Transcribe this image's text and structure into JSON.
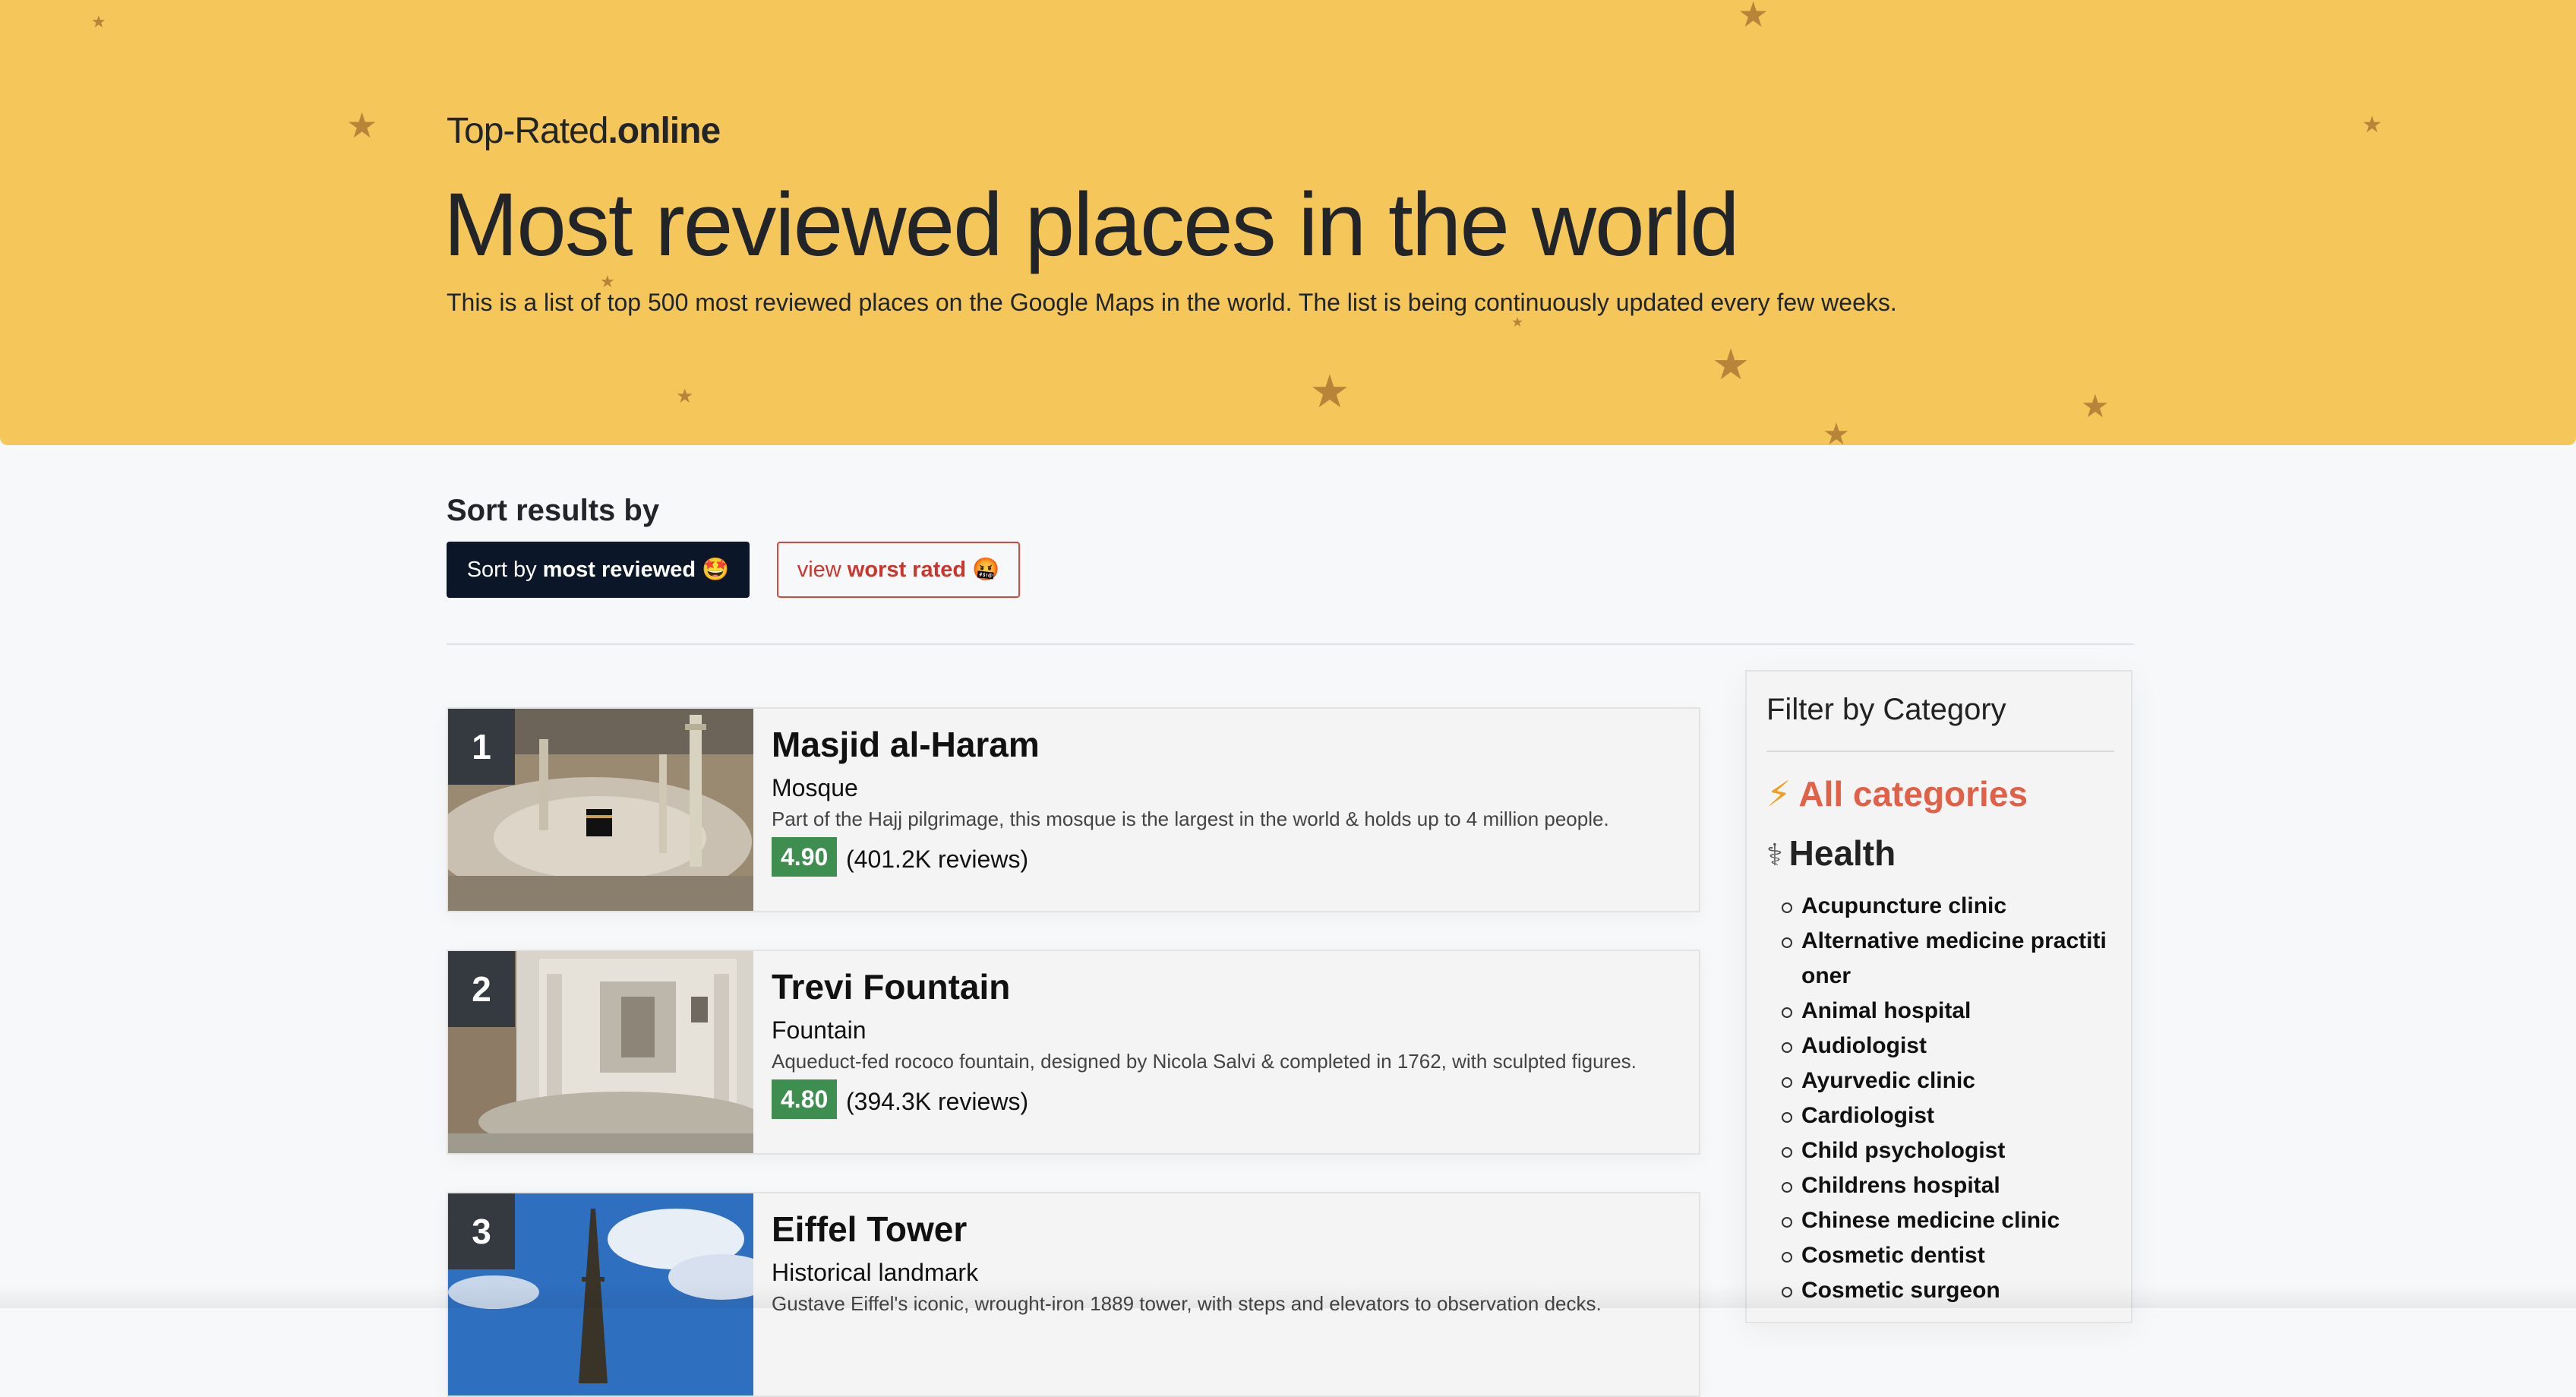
{
  "header": {
    "brand_light": "Top-Rated",
    "brand_bold": ".online",
    "title": "Most reviewed places in the world",
    "description": "This is a list of top 500 most reviewed places on the Google Maps in the world. The list is being continuously updated every few weeks.",
    "background_color": "#f5c65a"
  },
  "sort": {
    "heading": "Sort results by",
    "most_reviewed_prefix": "Sort by ",
    "most_reviewed_bold": "most reviewed",
    "most_reviewed_emoji": "🤩",
    "worst_rated_prefix": "view ",
    "worst_rated_bold": "worst rated",
    "worst_rated_emoji": "🤬"
  },
  "places": [
    {
      "rank": "1",
      "name": "Masjid al-Haram",
      "category": "Mosque",
      "description": "Part of the Hajj pilgrimage, this mosque is the largest in the world & holds up to 4 million people.",
      "rating": "4.90",
      "reviews": "(401.2K reviews)"
    },
    {
      "rank": "2",
      "name": "Trevi Fountain",
      "category": "Fountain",
      "description": "Aqueduct-fed rococo fountain, designed by Nicola Salvi & completed in 1762, with sculpted figures.",
      "rating": "4.80",
      "reviews": "(394.3K reviews)"
    },
    {
      "rank": "3",
      "name": "Eiffel Tower",
      "category": "Historical landmark",
      "description": "Gustave Eiffel's iconic, wrought-iron 1889 tower, with steps and elevators to observation decks.",
      "rating": "",
      "reviews": ""
    }
  ],
  "filter": {
    "title": "Filter by Category",
    "all_categories": "All categories",
    "group_health": "Health",
    "health_items": [
      "Acupuncture clinic",
      "Alternative medicine practitioner",
      "Animal hospital",
      "Audiologist",
      "Ayurvedic clinic",
      "Cardiologist",
      "Child psychologist",
      "Childrens hospital",
      "Chinese medicine clinic",
      "Cosmetic dentist",
      "Cosmetic surgeon"
    ]
  },
  "colors": {
    "rating_badge": "#3e8e4f",
    "primary_button": "#0b1628",
    "accent_red": "#d9463a",
    "all_categories": "#e06048"
  }
}
